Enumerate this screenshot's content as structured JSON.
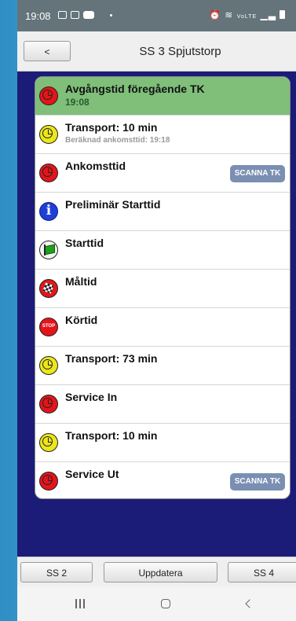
{
  "status_bar": {
    "time": "19:08",
    "network": "VoLTE"
  },
  "header": {
    "back_label": "<",
    "title": "SS 3 Spjutstorp"
  },
  "rows": [
    {
      "title": "Avgångstid föregående TK",
      "sub": "19:08",
      "icon": "clock-red-icon",
      "state": "done"
    },
    {
      "title": "Transport: 10 min",
      "sub": "Beräknad ankomsttid: 19:18",
      "icon": "clock-yellow-icon"
    },
    {
      "title": "Ankomsttid",
      "icon": "clock-red-icon",
      "button": "SCANNA TK"
    },
    {
      "title": "Preliminär Starttid",
      "icon": "info-icon"
    },
    {
      "title": "Starttid",
      "icon": "green-flag-icon"
    },
    {
      "title": "Måltid",
      "icon": "checkered-flag-icon"
    },
    {
      "title": "Körtid",
      "icon": "stop-sign-icon",
      "icon_text": "STOP"
    },
    {
      "title": "Transport: 73 min",
      "icon": "clock-yellow-icon"
    },
    {
      "title": "Service In",
      "icon": "clock-red-icon"
    },
    {
      "title": "Transport: 10 min",
      "icon": "clock-yellow-icon"
    },
    {
      "title": "Service Ut",
      "icon": "clock-red-icon",
      "button": "SCANNA TK"
    }
  ],
  "bottom_bar": {
    "prev_label": "SS 2",
    "refresh_label": "Uppdatera",
    "next_label": "SS 4"
  },
  "colors": {
    "background": "#1b1b78",
    "done_row": "#7fbf7a",
    "scan_button": "#7a8fb2",
    "status_bar": "#64747a"
  }
}
